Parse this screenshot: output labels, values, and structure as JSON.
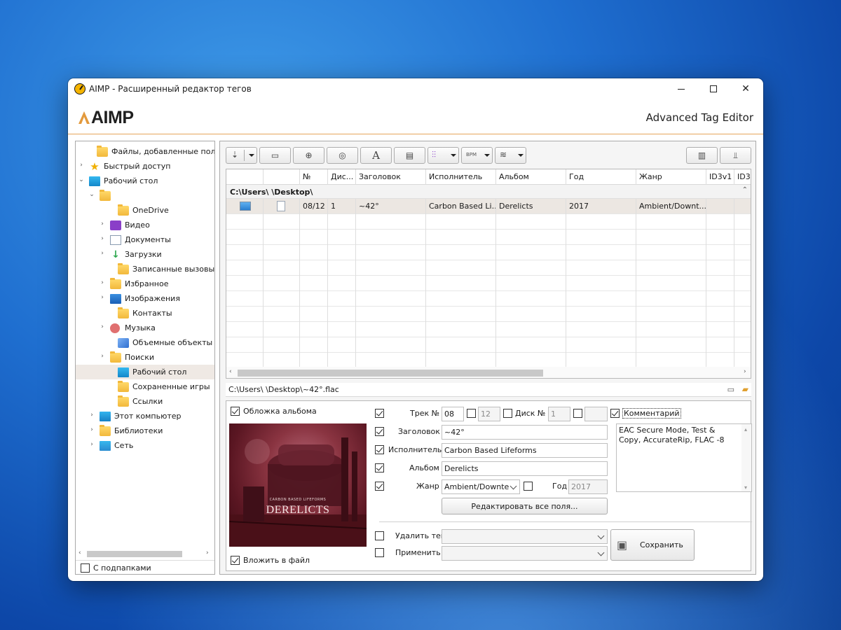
{
  "window": {
    "title": "AIMP - Расширенный редактор тегов",
    "brand_logo": "AIMP",
    "brand_title": "Advanced Tag Editor"
  },
  "tree": {
    "items": [
      {
        "label": "Файлы, добавленные пользователем",
        "icon": "folder-icon",
        "exp": ""
      },
      {
        "label": "Быстрый доступ",
        "icon": "star-icon",
        "exp": "›"
      },
      {
        "label": "Рабочий стол",
        "icon": "desktop-icon",
        "exp": "⌄"
      },
      {
        "label": "",
        "icon": "folder-icon",
        "exp": "⌄"
      },
      {
        "label": "OneDrive",
        "icon": "folder-icon",
        "exp": ""
      },
      {
        "label": "Видео",
        "icon": "video-icon",
        "exp": "›"
      },
      {
        "label": "Документы",
        "icon": "documents-icon",
        "exp": "›"
      },
      {
        "label": "Загрузки",
        "icon": "downloads-icon",
        "exp": "›"
      },
      {
        "label": "Записанные вызовы",
        "icon": "folder-icon",
        "exp": ""
      },
      {
        "label": "Избранное",
        "icon": "folder-icon",
        "exp": "›"
      },
      {
        "label": "Изображения",
        "icon": "pictures-icon",
        "exp": "›"
      },
      {
        "label": "Контакты",
        "icon": "folder-icon",
        "exp": ""
      },
      {
        "label": "Музыка",
        "icon": "music-icon",
        "exp": "›"
      },
      {
        "label": "Объемные объекты",
        "icon": "3d-objects-icon",
        "exp": ""
      },
      {
        "label": "Поиски",
        "icon": "folder-icon",
        "exp": "›"
      },
      {
        "label": "Рабочий стол",
        "icon": "desktop-icon",
        "exp": ""
      },
      {
        "label": "Сохраненные игры",
        "icon": "folder-icon",
        "exp": ""
      },
      {
        "label": "Ссылки",
        "icon": "folder-icon",
        "exp": ""
      },
      {
        "label": "Этот компьютер",
        "icon": "computer-icon",
        "exp": "›"
      },
      {
        "label": "Библиотеки",
        "icon": "folder-icon",
        "exp": "›"
      },
      {
        "label": "Сеть",
        "icon": "network-icon",
        "exp": "›"
      }
    ],
    "selected_index": 15,
    "subfolders_label": "С подпапками",
    "subfolders_checked": false
  },
  "toolbar": {
    "bpm_label": "BPM"
  },
  "grid": {
    "columns": [
      "",
      "",
      "№",
      "Дис...",
      "Заголовок",
      "Исполнитель",
      "Альбом",
      "Год",
      "Жанр",
      "ID3v1",
      "ID3"
    ],
    "group_label": "C:\\Users\\        \\Desktop\\",
    "group_toggle": "⌃",
    "rows": [
      {
        "track": "08/12",
        "disc": "1",
        "title": "~42°",
        "artist": "Carbon Based Li...",
        "album": "Derelicts",
        "year": "2017",
        "genre": "Ambient/Downt..."
      }
    ]
  },
  "path": "C:\\Users\\        \\Desktop\\~42°.flac",
  "editor": {
    "cover_label": "Обложка альбома",
    "cover_checked": true,
    "cover_art_text": "DERELICTS",
    "cover_art_subtext": "CARBON BASED LIFEFORMS",
    "embed_label": "Вложить в файл",
    "embed_checked": true,
    "track_label": "Трек №",
    "track_value": "08",
    "track_total": "12",
    "disc_label": "Диск №",
    "disc_value": "1",
    "disc_total": "",
    "comment_label": "Комментарий",
    "comment_value": "EAC Secure Mode, Test & Copy, AccurateRip, FLAC -8",
    "title_label": "Заголовок",
    "title_value": "~42°",
    "artist_label": "Исполнитель",
    "artist_value": "Carbon Based Lifeforms",
    "album_label": "Альбом",
    "album_value": "Derelicts",
    "genre_label": "Жанр",
    "genre_value": "Ambient/Downte",
    "year_label": "Год",
    "year_value": "2017",
    "edit_all_label": "Редактировать все поля...",
    "remove_tag_label": "Удалить тег",
    "apply_to_label": "Применить к",
    "save_label": "Сохранить"
  },
  "colors": {
    "accent_line": "#e6a55b",
    "selection": "#efe9e4"
  }
}
